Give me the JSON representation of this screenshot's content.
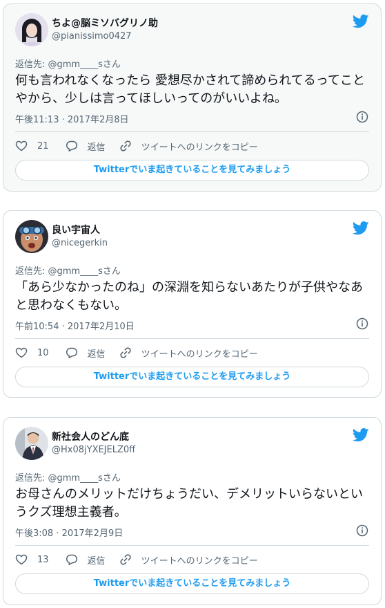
{
  "colors": {
    "accent": "#1d9bf0",
    "text": "#0f1419",
    "muted": "#536471",
    "border": "#cfd9de"
  },
  "tweets": [
    {
      "name": "ちよ@脳ミソバグリノ助",
      "handle": "@pianissimo0427",
      "reply_to": "返信先: @gmm____sさん",
      "text": "何も言われなくなったら 愛想尽かされて諦められてるってことやから、少しは言ってほしいってのがいいよね。",
      "timestamp": "午後11:13 · 2017年2月8日",
      "likes": "21",
      "reply_label": "返信",
      "copy_link_label": "ツイートへのリンクをコピー",
      "cta_label": "Twitterでいま起きていることを見てみましょう",
      "avatar_icon": "avatar-woman-dark-hair"
    },
    {
      "name": "良い宇宙人",
      "handle": "@nicegerkin",
      "reply_to": "返信先: @gmm____sさん",
      "text": "「あら少なかったのね」の深淵を知らないあたりが子供やなあと思わなくもない。",
      "timestamp": "午前10:54 · 2017年2月10日",
      "likes": "10",
      "reply_label": "返信",
      "copy_link_label": "ツイートへのリンクをコピー",
      "cta_label": "Twitterでいま起きていることを見てみましょう",
      "avatar_icon": "avatar-man-goggles"
    },
    {
      "name": "新社会人のどん底",
      "handle": "@Hx08jYXEJELZ0ff",
      "reply_to": "返信先: @gmm____sさん",
      "text": "お母さんのメリットだけちょうだい、デメリットいらないというクズ理想主義者。",
      "timestamp": "午後3:08 · 2017年2月9日",
      "likes": "13",
      "reply_label": "返信",
      "copy_link_label": "ツイートへのリンクをコピー",
      "cta_label": "Twitterでいま起きていることを見てみましょう",
      "avatar_icon": "avatar-man-suit"
    }
  ]
}
